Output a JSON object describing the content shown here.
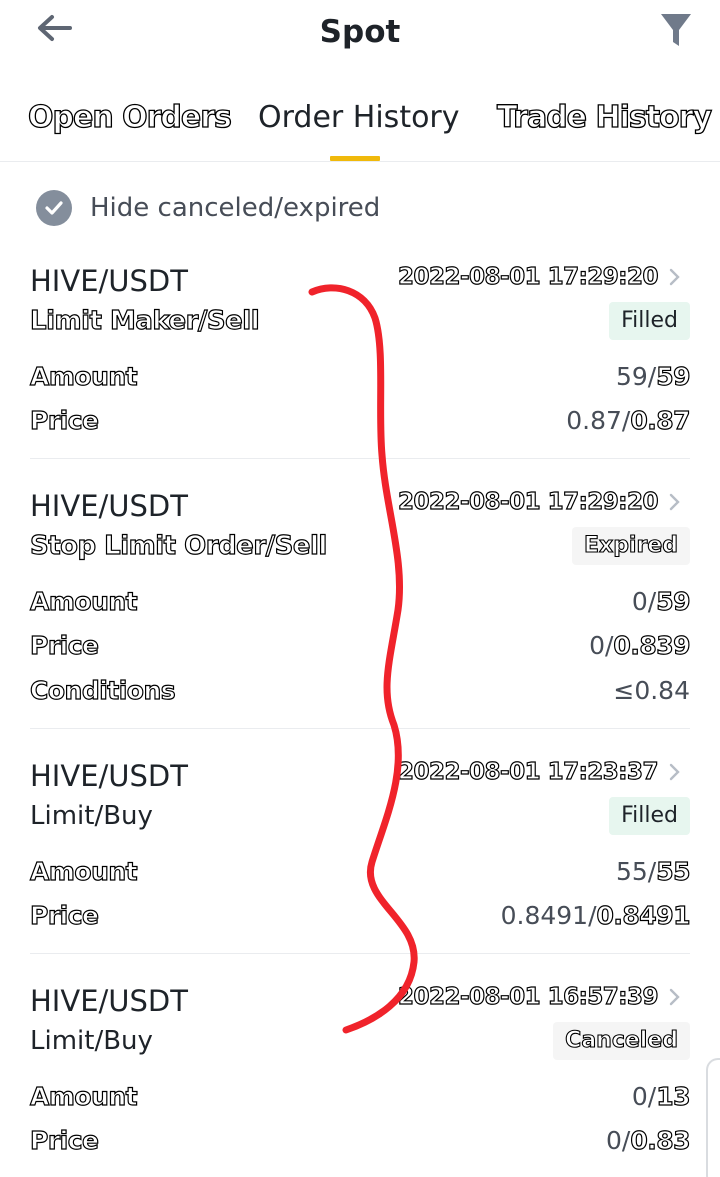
{
  "header": {
    "title": "Spot",
    "back_icon": "back-arrow-icon",
    "filter_icon": "filter-funnel-icon"
  },
  "tabs": [
    {
      "label": "Open Orders",
      "active": false
    },
    {
      "label": "Order History",
      "active": true
    },
    {
      "label": "Trade History",
      "active": false
    }
  ],
  "filter": {
    "hide_label": "Hide canceled/expired",
    "checked": true
  },
  "orders": [
    {
      "pair": "HIVE/USDT",
      "datetime": "2022-08-01 17:29:20",
      "type": "Limit Maker/Sell",
      "status": "Filled",
      "amount_label": "Amount",
      "amount_filled": "59/",
      "amount_total": "59",
      "price_label": "Price",
      "price_avg": "0.87/",
      "price_order": "0.87"
    },
    {
      "pair": "HIVE/USDT",
      "datetime": "2022-08-01 17:29:20",
      "type": "Stop Limit Order/Sell",
      "status": "Expired",
      "amount_label": "Amount",
      "amount_filled": "0/",
      "amount_total": "59",
      "price_label": "Price",
      "price_avg": "0/",
      "price_order": "0.839",
      "conditions_label": "Conditions",
      "conditions_value": "≤0.84"
    },
    {
      "pair": "HIVE/USDT",
      "datetime": "2022-08-01 17:23:37",
      "type": "Limit/Buy",
      "status": "Filled",
      "amount_label": "Amount",
      "amount_filled": "55/",
      "amount_total": "55",
      "price_label": "Price",
      "price_avg": "0.8491/",
      "price_order": "0.8491"
    },
    {
      "pair": "HIVE/USDT",
      "datetime": "2022-08-01 16:57:39",
      "type": "Limit/Buy",
      "status": "Canceled",
      "amount_label": "Amount",
      "amount_filled": "0/",
      "amount_total": "13",
      "price_label": "Price",
      "price_avg": "0/",
      "price_order": "0.83"
    }
  ],
  "colors": {
    "accent": "#f0b90b",
    "filled_badge_bg": "#e7f6ef",
    "annotation_red": "#f0232b"
  }
}
